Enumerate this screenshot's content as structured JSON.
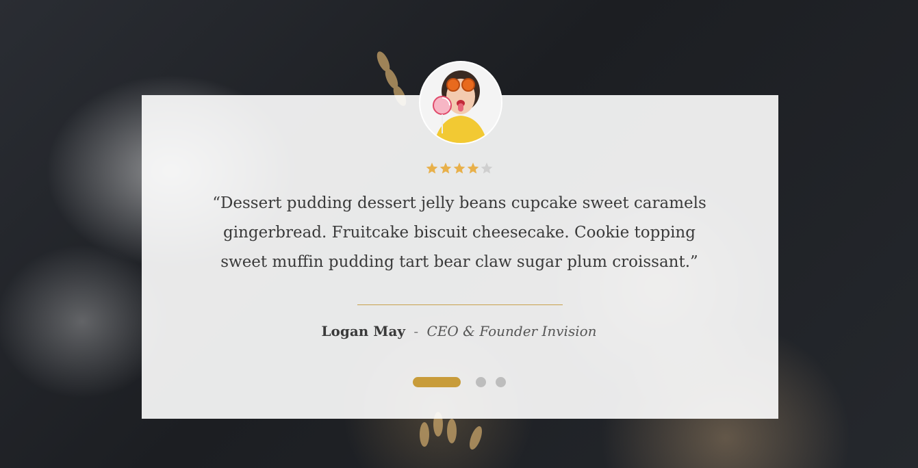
{
  "testimonial": {
    "rating": 4,
    "max_rating": 5,
    "quote": "“Dessert pudding dessert jelly beans cupcake sweet caramels gingerbread. Fruitcake biscuit cheesecake. Cookie topping sweet muffin pudding tart bear claw sugar plum croissant.”",
    "author_name": "Logan May",
    "separator": "-",
    "author_role": "CEO & Founder Invision"
  },
  "slider": {
    "dots": 3,
    "active_index": 0
  },
  "colors": {
    "accent": "#c89c3a",
    "star_filled": "#e8b04a",
    "star_empty": "#cfcfcf",
    "dot_inactive": "#bdbdbd",
    "text": "#3a3a3a"
  }
}
